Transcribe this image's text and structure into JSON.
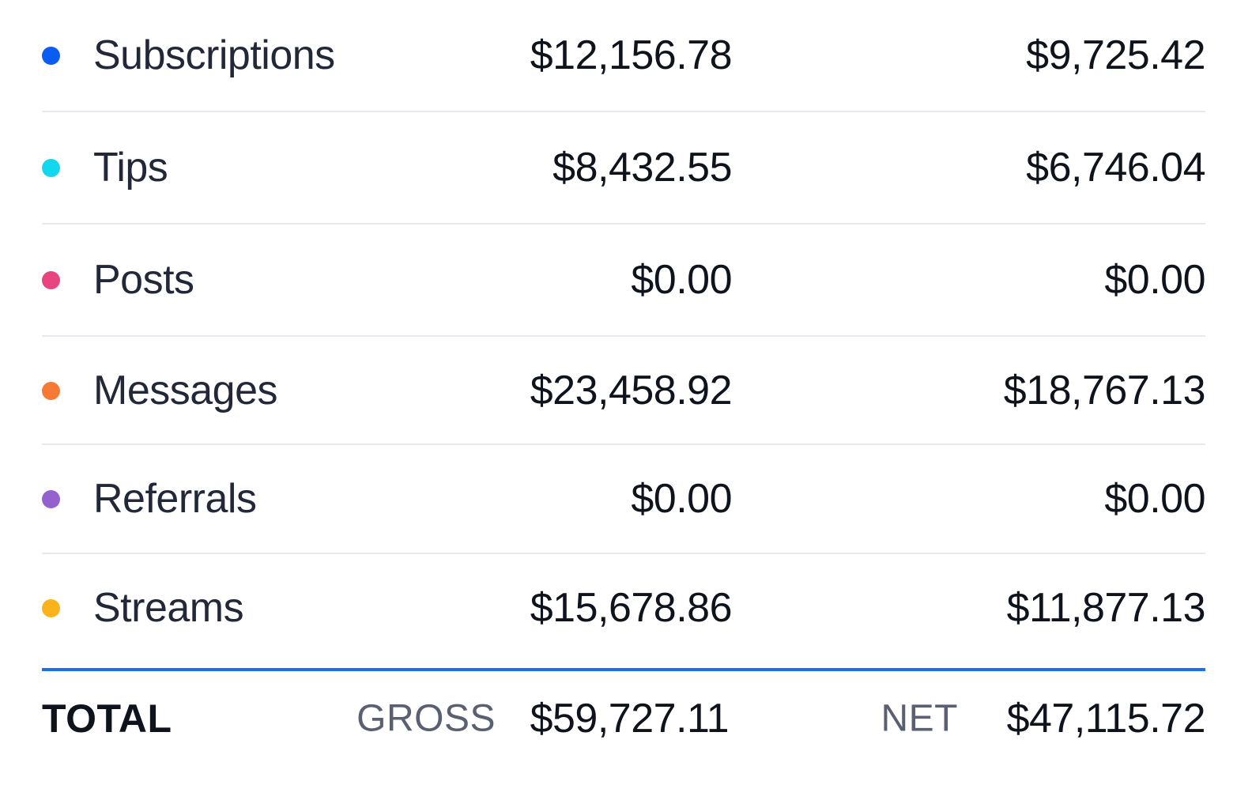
{
  "rows": [
    {
      "label": "Subscriptions",
      "gross": "$12,156.78",
      "net": "$9,725.42",
      "color": "#0b5cf0"
    },
    {
      "label": "Tips",
      "gross": "$8,432.55",
      "net": "$6,746.04",
      "color": "#13d6ef"
    },
    {
      "label": "Posts",
      "gross": "$0.00",
      "net": "$0.00",
      "color": "#e8447f"
    },
    {
      "label": "Messages",
      "gross": "$23,458.92",
      "net": "$18,767.13",
      "color": "#f77a34"
    },
    {
      "label": "Referrals",
      "gross": "$0.00",
      "net": "$0.00",
      "color": "#9461cf"
    },
    {
      "label": "Streams",
      "gross": "$15,678.86",
      "net": "$11,877.13",
      "color": "#fbb21b"
    }
  ],
  "total": {
    "label": "TOTAL",
    "gross_caption": "GROSS",
    "gross_value": "$59,727.11",
    "net_caption": "NET",
    "net_value": "$47,115.72"
  },
  "accent_color": "#1a6ff0"
}
